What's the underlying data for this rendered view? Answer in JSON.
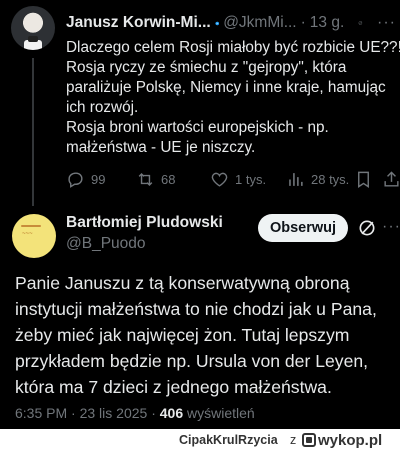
{
  "colors": {
    "background": "#000000",
    "text": "#e7e9ea",
    "muted": "#71767b",
    "verified": "#1d9bf0",
    "follow_bg": "#eff3f4"
  },
  "reply_tweet": {
    "author_name": "Janusz Korwin-Mi...",
    "handle": "@JkmMi...",
    "separator": "·",
    "time": "13 g.",
    "more": "···",
    "lines": [
      "Dlaczego celem Rosji miałoby być rozbicie UE??!?",
      "Rosja ryczy ze śmiechu z \"gejropy\", która",
      "paraliżuje Polskę, Niemcy i inne kraje, hamując",
      "ich rozwój.",
      "Rosja broni wartości europejskich - np.",
      "małżeństwa - UE je niszczy."
    ],
    "replies": "99",
    "reposts": "68",
    "likes": "1 tys.",
    "views": "28 tys.",
    "icons": [
      "comment-icon",
      "repost-icon",
      "heart-icon",
      "views-icon",
      "bookmark-icon"
    ]
  },
  "main_tweet": {
    "author_name": "Bartłomiej Pludowski",
    "handle": "@B_Puodo",
    "follow_label": "Obserwuj",
    "more": "···",
    "lines": [
      "Panie Januszu z tą konserwatywną obroną",
      "instytucji małżeństwa to nie chodzi jak u Pana,",
      "żeby mieć jak najwięcej żon. Tutaj lepszym",
      "przykładem będzie np. Ursula von der Leyen,",
      "która ma 7 dzieci z jednego małżeństwa."
    ],
    "time": "6:35 PM",
    "separator": "·",
    "date": "23 lis 2025",
    "views_count": "406",
    "views_label": "wyświetleń"
  },
  "footer": {
    "username": "CipakKrulRzycia",
    "z": "z",
    "site": "wykop.pl"
  }
}
